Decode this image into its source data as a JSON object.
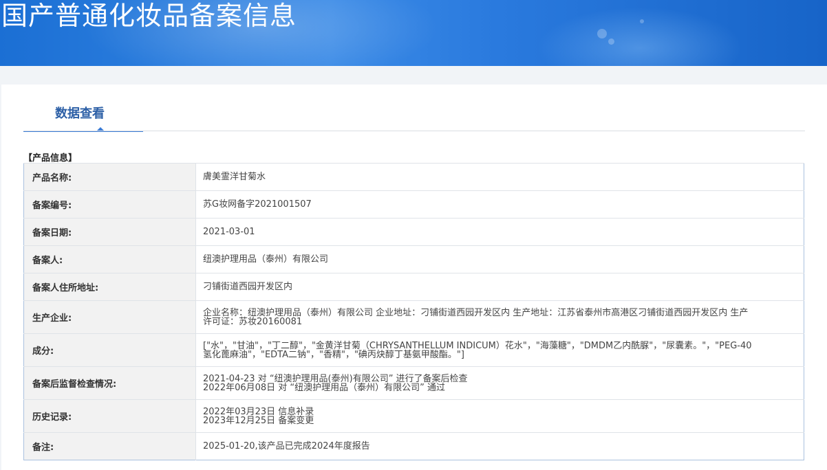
{
  "banner": {
    "title": "国产普通化妆品备案信息"
  },
  "tabs": [
    {
      "label": "数据查看",
      "active": true
    }
  ],
  "section": {
    "heading": "【产品信息】"
  },
  "rows": [
    {
      "label": "产品名称:",
      "lines": [
        "膚美霊洋甘菊水"
      ]
    },
    {
      "label": "备案编号:",
      "lines": [
        "苏G妆网备字2021001507"
      ]
    },
    {
      "label": "备案日期:",
      "lines": [
        "2021-03-01"
      ]
    },
    {
      "label": "备案人:",
      "lines": [
        "纽澳护理用品（泰州）有限公司"
      ]
    },
    {
      "label": "备案人住所地址:",
      "lines": [
        "刁铺街道西园开发区内"
      ]
    },
    {
      "label": "生产企业:",
      "lines": [
        "企业名称：纽澳护理用品（泰州）有限公司 企业地址：刁铺街道西园开发区内 生产地址：江苏省泰州市高港区刁铺街道西园开发区内 生产",
        "许可证：苏妆20160081"
      ]
    },
    {
      "label": "成分:",
      "lines": [
        "[\"水\"，\"甘油\"，\"丁二醇\"，\"金黄洋甘菊（CHRYSANTHELLUM INDICUM）花水\"，\"海藻糖\"，\"DMDM乙内酰脲\"，\"尿囊素。\"，\"PEG-40",
        "氢化蓖麻油\"，\"EDTA二钠\"，\"香精\"，\"碘丙炔醇丁基氨甲酸酯。\"]"
      ]
    },
    {
      "label": "备案后监督检查情况:",
      "lines": [
        "2021-04-23 对 “纽澳护理用品(泰州)有限公司” 进行了备案后检查",
        "2022年06月08日 对 “纽澳护理用品（泰州）有限公司” 通过"
      ]
    },
    {
      "label": "历史记录:",
      "lines": [
        "2022年03月23日 信息补录",
        "2023年12月25日 备案变更"
      ]
    },
    {
      "label": "备注:",
      "lines": [
        "2025-01-20,该产品已完成2024年度报告"
      ]
    }
  ],
  "colors": {
    "banner": "#1b6fd4",
    "tab_active_text": "#2c5fa6",
    "tab_underline": "#3a7bd5",
    "table_border": "#a9c1de",
    "label_bg": "#f2f2f2"
  }
}
